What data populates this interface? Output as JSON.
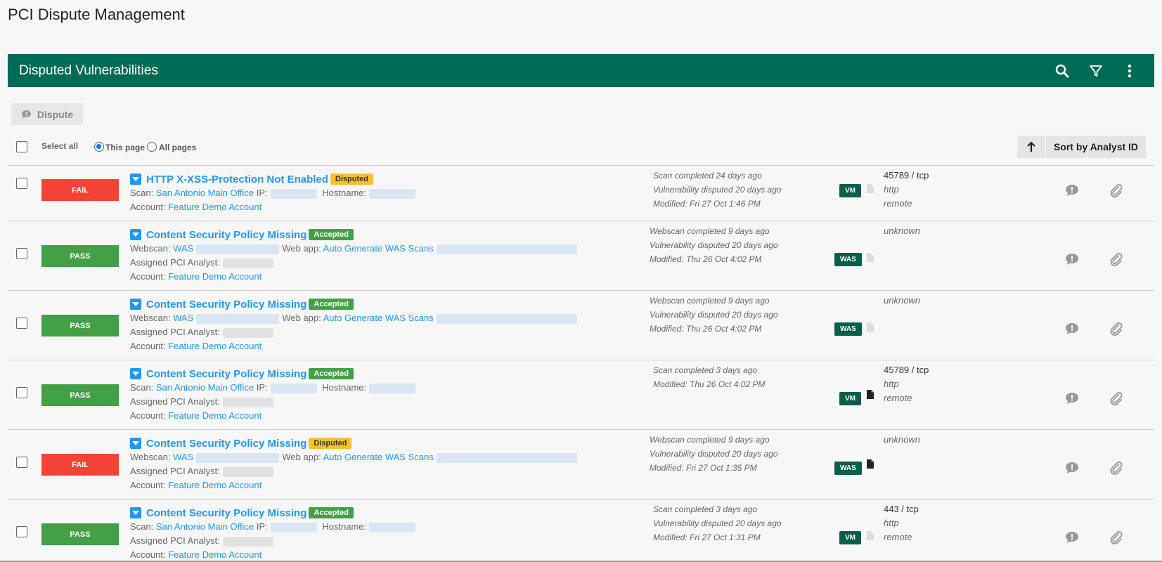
{
  "page": {
    "title": "PCI Dispute Management"
  },
  "panel": {
    "title": "Disputed Vulnerabilities",
    "icons": [
      "search-icon",
      "filter-icon",
      "more-vert-icon"
    ]
  },
  "toolbar": {
    "dispute_label": "Dispute"
  },
  "selection": {
    "select_all_label": "Select all",
    "this_page_label": "This page",
    "all_pages_label": "All pages",
    "selected": "This page"
  },
  "sort": {
    "label": "Sort by Analyst ID",
    "direction_icon": "arrow-up-icon"
  },
  "colors": {
    "header": "#006b54",
    "fail": "#f44336",
    "pass": "#43a047",
    "disputed": "#fbc02d",
    "accepted": "#43a047",
    "link": "#2196f3",
    "badge": "#0a5e4a"
  },
  "rows": [
    {
      "status": "FAIL",
      "title": "HTTP X-XSS-Protection Not Enabled",
      "tag": "Disputed",
      "kind": "scan",
      "scan_label": "Scan:",
      "scan_value": "San Antonio Main Office",
      "ip_label": "IP:",
      "hostname_label": "Hostname:",
      "analyst_label": "",
      "account_label": "Account:",
      "account_value": "Feature Demo Account",
      "timeline": [
        "Scan completed 24 days ago",
        "Vulnerability disputed 20 days ago",
        "Modified: Fri 27 Oct     1:46 PM"
      ],
      "badge": "VM",
      "doc_filled": false,
      "ports": {
        "port": "45789 / tcp",
        "service": "http",
        "mode": "remote"
      }
    },
    {
      "status": "PASS",
      "title": "Content Security Policy Missing",
      "tag": "Accepted",
      "kind": "webscan",
      "scan_label": "Webscan:",
      "scan_value": "WAS",
      "webapp_label": "Web app:",
      "webapp_value": "Auto Generate WAS Scans",
      "analyst_label": "Assigned PCI Analyst:",
      "account_label": "Account:",
      "account_value": "Feature Demo Account",
      "timeline": [
        "Webscan completed 9 days ago",
        "Vulnerability disputed 20 days ago",
        "Modified: Thu 26 Oct     4:02 PM"
      ],
      "badge": "WAS",
      "doc_filled": false,
      "ports": {
        "port": "unknown"
      }
    },
    {
      "status": "PASS",
      "title": "Content Security Policy Missing",
      "tag": "Accepted",
      "kind": "webscan",
      "scan_label": "Webscan:",
      "scan_value": "WAS",
      "webapp_label": "Web app:",
      "webapp_value": "Auto Generate WAS Scans",
      "analyst_label": "Assigned PCI Analyst:",
      "account_label": "Account:",
      "account_value": "Feature Demo Account",
      "timeline": [
        "Webscan completed 9 days ago",
        "Vulnerability disputed 20 days ago",
        "Modified: Thu 26 Oct     4:02 PM"
      ],
      "badge": "WAS",
      "doc_filled": false,
      "ports": {
        "port": "unknown"
      }
    },
    {
      "status": "PASS",
      "title": "Content Security Policy Missing",
      "tag": "Accepted",
      "kind": "scan",
      "scan_label": "Scan:",
      "scan_value": "San Antonio Main Office",
      "ip_label": "IP:",
      "hostname_label": "Hostname:",
      "analyst_label": "Assigned PCI Analyst:",
      "account_label": "Account:",
      "account_value": "Feature Demo Account",
      "timeline": [
        "Scan completed 3 days ago",
        "Modified: Thu 26 Oct     4:02 PM"
      ],
      "badge": "VM",
      "doc_filled": true,
      "ports": {
        "port": "45789 / tcp",
        "service": "http",
        "mode": "remote"
      }
    },
    {
      "status": "FAIL",
      "title": "Content Security Policy Missing",
      "tag": "Disputed",
      "kind": "webscan",
      "scan_label": "Webscan:",
      "scan_value": "WAS",
      "webapp_label": "Web app:",
      "webapp_value": "Auto Generate WAS Scans",
      "analyst_label": "Assigned PCI Analyst:",
      "account_label": "Account:",
      "account_value": "Feature Demo Account",
      "timeline": [
        "Webscan completed 9 days ago",
        "Vulnerability disputed 20 days ago",
        "Modified: Fri 27 Oct     1:35 PM"
      ],
      "badge": "WAS",
      "doc_filled": true,
      "ports": {
        "port": "unknown"
      }
    },
    {
      "status": "PASS",
      "title": "Content Security Policy Missing",
      "tag": "Accepted",
      "kind": "scan",
      "scan_label": "Scan:",
      "scan_value": "San Antonio Main Office",
      "ip_label": "IP:",
      "hostname_label": "Hostname:",
      "analyst_label": "Assigned PCI Analyst:",
      "account_label": "Account:",
      "account_value": "Feature Demo Account",
      "timeline": [
        "Scan completed 3 days ago",
        "Vulnerability disputed 20 days ago",
        "Modified: Fri 27 Oct     1:31 PM"
      ],
      "badge": "VM",
      "doc_filled": false,
      "ports": {
        "port": "443 / tcp",
        "service": "http",
        "mode": "remote"
      }
    }
  ]
}
